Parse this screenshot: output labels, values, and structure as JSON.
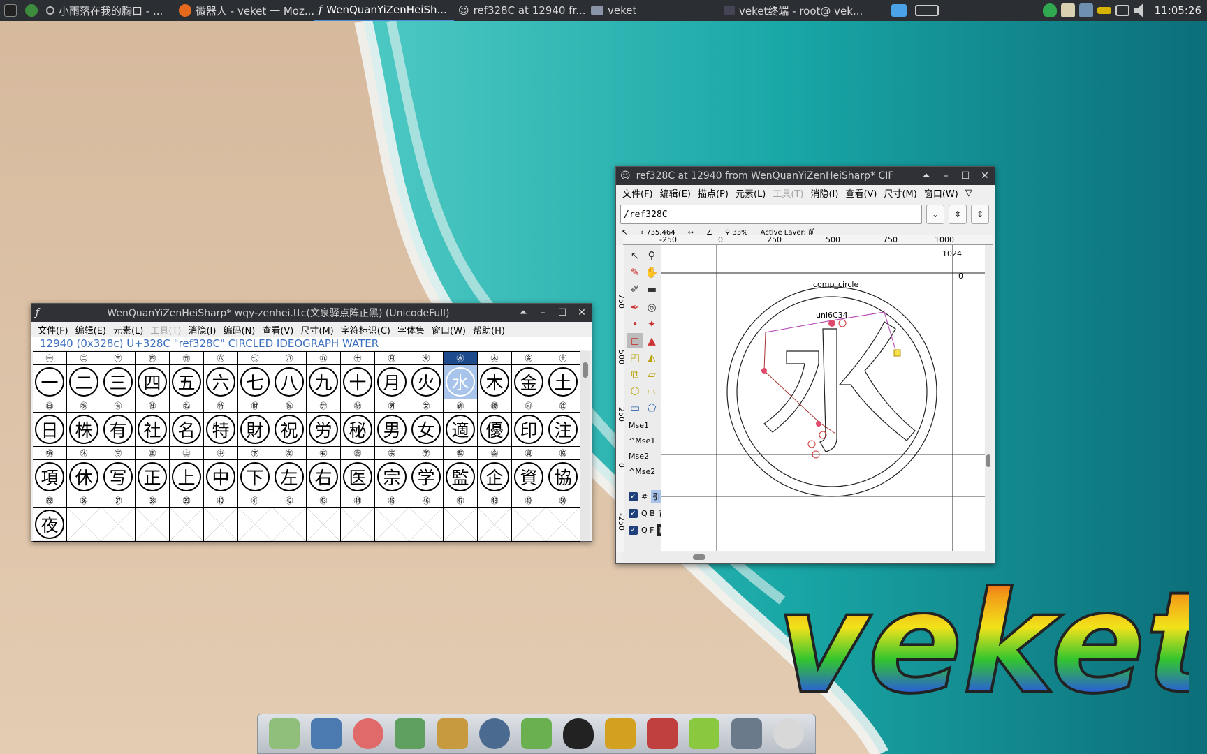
{
  "taskbar": {
    "launchers": [
      "terminal-icon",
      "browser-icon"
    ],
    "tasks": [
      {
        "label": "小雨落在我的胸口 - ..."
      },
      {
        "label": "微器人 - veket 一 Moz..."
      },
      {
        "label": "WenQuanYiZenHeiSh..."
      },
      {
        "label": "ref328C at 12940 fr..."
      },
      {
        "label": "veket"
      },
      {
        "label": "veket终端 - root@ vek..."
      }
    ],
    "clock": "11:05:26"
  },
  "font_window": {
    "title": "WenQuanYiZenHeiSharp*  wqy-zenhei.ttc(文泉驿点阵正黑) (UnicodeFull)",
    "menu": [
      "文件(F)",
      "编辑(E)",
      "元素(L)",
      "工具(T)",
      "消隐(I)",
      "编码(N)",
      "查看(V)",
      "尺寸(M)",
      "字符标识(C)",
      "字体集",
      "窗口(W)",
      "帮助(H)"
    ],
    "disabled_menu": [
      "工具(T)"
    ],
    "char_info": "12940 (0x328c) U+328C \"ref328C\" CIRCLED IDEOGRAPH WATER",
    "rows": [
      {
        "labels": [
          "㊀",
          "㊁",
          "㊂",
          "㊃",
          "㊄",
          "㊅",
          "㊆",
          "㊇",
          "㊈",
          "㊉",
          "㊊",
          "㊋",
          "㊌",
          "㊍",
          "㊎",
          "㊏"
        ],
        "glyphs": [
          "一",
          "二",
          "三",
          "四",
          "五",
          "六",
          "七",
          "八",
          "九",
          "十",
          "月",
          "火",
          "水",
          "木",
          "金",
          "土"
        ]
      },
      {
        "labels": [
          "㊐",
          "㊑",
          "㊒",
          "㊓",
          "㊔",
          "㊕",
          "㊖",
          "㊗",
          "㊘",
          "㊙",
          "㊚",
          "㊛",
          "㊜",
          "㊝",
          "㊞",
          "㊟"
        ],
        "glyphs": [
          "日",
          "株",
          "有",
          "社",
          "名",
          "特",
          "財",
          "祝",
          "労",
          "秘",
          "男",
          "女",
          "適",
          "優",
          "印",
          "注"
        ]
      },
      {
        "labels": [
          "㊠",
          "㊡",
          "㊢",
          "㊣",
          "㊤",
          "㊥",
          "㊦",
          "㊧",
          "㊨",
          "㊩",
          "㊪",
          "㊫",
          "㊬",
          "㊭",
          "㊮",
          "㊯"
        ],
        "glyphs": [
          "項",
          "休",
          "写",
          "正",
          "上",
          "中",
          "下",
          "左",
          "右",
          "医",
          "宗",
          "学",
          "監",
          "企",
          "資",
          "協"
        ]
      },
      {
        "labels": [
          "㊰",
          "㊱",
          "㊲",
          "㊳",
          "㊴",
          "㊵",
          "㊶",
          "㊷",
          "㊸",
          "㊹",
          "㊺",
          "㊻",
          "㊼",
          "㊽",
          "㊾",
          "㊿"
        ],
        "glyphs": [
          "夜",
          "",
          "",
          "",
          "",
          "",
          "",
          "",
          "",
          "",
          "",
          "",
          "",
          "",
          "",
          ""
        ]
      }
    ],
    "selected_glyph": "水"
  },
  "glyph_window": {
    "title": "ref328C at 12940 from WenQuanYiZenHeiSharp* CIF",
    "menu": [
      "文件(F)",
      "编辑(E)",
      "描点(P)",
      "元素(L)",
      "工具(T)",
      "消隐(I)",
      "查看(V)",
      "尺寸(M)",
      "窗口(W)"
    ],
    "disabled_menu": [
      "工具(T)"
    ],
    "name_field": "/ref328C",
    "cursor_pos": "735,464",
    "zoom": "33%",
    "active_layer": "Active Layer: 前",
    "ruler_ticks": [
      "-250",
      "0",
      "250",
      "500",
      "750",
      "1000"
    ],
    "vruler_ticks": [
      "750",
      "500",
      "250",
      "0",
      "-250"
    ],
    "canvas_labels": {
      "top_right": "1024",
      "zero": "0",
      "comp_circle": "comp_circle",
      "uni_ref": "uni6C34"
    },
    "mouse_labels": [
      "Mse1",
      "^Mse1",
      "Mse2",
      "^Mse2"
    ],
    "layers": [
      {
        "flag": "#",
        "name": "引导层"
      },
      {
        "flag": "Q B",
        "name": "背景"
      },
      {
        "flag": "Q F",
        "name": "前景"
      }
    ]
  },
  "dock": {
    "icons": [
      "file-manager-icon",
      "computer-icon",
      "pet-icon",
      "editor-icon",
      "paint-icon",
      "speaker-icon",
      "network-icon",
      "penguin-icon",
      "door-icon",
      "chart-icon",
      "help-icon",
      "drive-icon",
      "settings-icon"
    ]
  },
  "logo": {
    "text": "veket"
  }
}
